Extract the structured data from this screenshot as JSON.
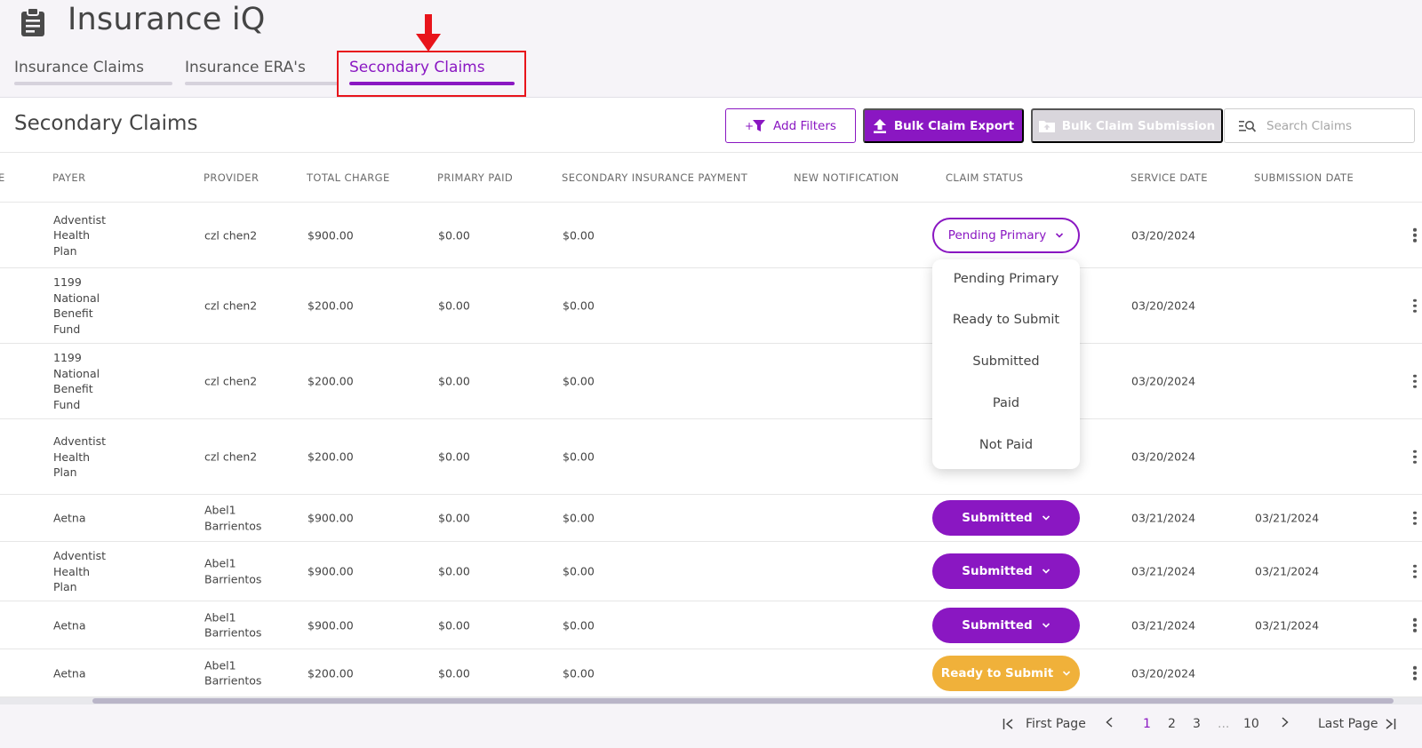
{
  "app": {
    "title": "Insurance iQ",
    "icon": "clipboard-icon"
  },
  "tabs": [
    {
      "label": "Insurance Claims",
      "active": false
    },
    {
      "label": "Insurance ERA's",
      "active": false
    },
    {
      "label": "Secondary Claims",
      "active": true
    }
  ],
  "page": {
    "title": "Secondary Claims"
  },
  "toolbar": {
    "add_filters": "Add Filters",
    "bulk_export": "Bulk Claim Export",
    "bulk_submission": "Bulk Claim Submission",
    "search_placeholder": "Search Claims"
  },
  "table": {
    "partial_first_header": "E",
    "headers": [
      "PAYER",
      "PROVIDER",
      "TOTAL CHARGE",
      "PRIMARY PAID",
      "SECONDARY INSURANCE PAYMENT",
      "NEW NOTIFICATION",
      "CLAIM STATUS",
      "SERVICE DATE",
      "SUBMISSION DATE"
    ],
    "rows": [
      {
        "payer": [
          "Adventist",
          "Health",
          "Plan"
        ],
        "provider": [
          "czl chen2"
        ],
        "total": "$900.00",
        "primary": "$0.00",
        "secondary": "$0.00",
        "status": "Pending Primary",
        "status_type": "pending",
        "service": "03/20/2024",
        "submission": ""
      },
      {
        "payer": [
          "1199",
          "National",
          "Benefit",
          "Fund"
        ],
        "provider": [
          "czl chen2"
        ],
        "total": "$200.00",
        "primary": "$0.00",
        "secondary": "$0.00",
        "status": "",
        "status_type": "hidden",
        "service": "03/20/2024",
        "submission": ""
      },
      {
        "payer": [
          "1199",
          "National",
          "Benefit",
          "Fund"
        ],
        "provider": [
          "czl chen2"
        ],
        "total": "$200.00",
        "primary": "$0.00",
        "secondary": "$0.00",
        "status": "",
        "status_type": "hidden",
        "service": "03/20/2024",
        "submission": ""
      },
      {
        "payer": [
          "Adventist",
          "Health",
          "Plan"
        ],
        "provider": [
          "czl chen2"
        ],
        "total": "$200.00",
        "primary": "$0.00",
        "secondary": "$0.00",
        "status": "",
        "status_type": "hidden",
        "service": "03/20/2024",
        "submission": ""
      },
      {
        "payer": [
          "Aetna"
        ],
        "provider": [
          "Abel1",
          "Barrientos"
        ],
        "total": "$900.00",
        "primary": "$0.00",
        "secondary": "$0.00",
        "status": "Submitted",
        "status_type": "submitted",
        "service": "03/21/2024",
        "submission": "03/21/2024"
      },
      {
        "payer": [
          "Adventist",
          "Health",
          "Plan"
        ],
        "provider": [
          "Abel1",
          "Barrientos"
        ],
        "total": "$900.00",
        "primary": "$0.00",
        "secondary": "$0.00",
        "status": "Submitted",
        "status_type": "submitted",
        "service": "03/21/2024",
        "submission": "03/21/2024"
      },
      {
        "payer": [
          "Aetna"
        ],
        "provider": [
          "Abel1",
          "Barrientos"
        ],
        "total": "$900.00",
        "primary": "$0.00",
        "secondary": "$0.00",
        "status": "Submitted",
        "status_type": "submitted",
        "service": "03/21/2024",
        "submission": "03/21/2024"
      },
      {
        "payer": [
          "Aetna"
        ],
        "provider": [
          "Abel1",
          "Barrientos"
        ],
        "total": "$200.00",
        "primary": "$0.00",
        "secondary": "$0.00",
        "status": "Ready to Submit",
        "status_type": "ready",
        "service": "03/20/2024",
        "submission": ""
      }
    ]
  },
  "status_dropdown": {
    "options": [
      "Pending Primary",
      "Ready to Submit",
      "Submitted",
      "Paid",
      "Not Paid"
    ]
  },
  "pagination": {
    "first": "First Page",
    "pages": [
      "1",
      "2",
      "3",
      "...",
      "10"
    ],
    "current": "1",
    "last": "Last Page"
  },
  "colors": {
    "accent": "#8a17c2",
    "ready": "#f0b13a",
    "annotation": "#e8141b"
  }
}
